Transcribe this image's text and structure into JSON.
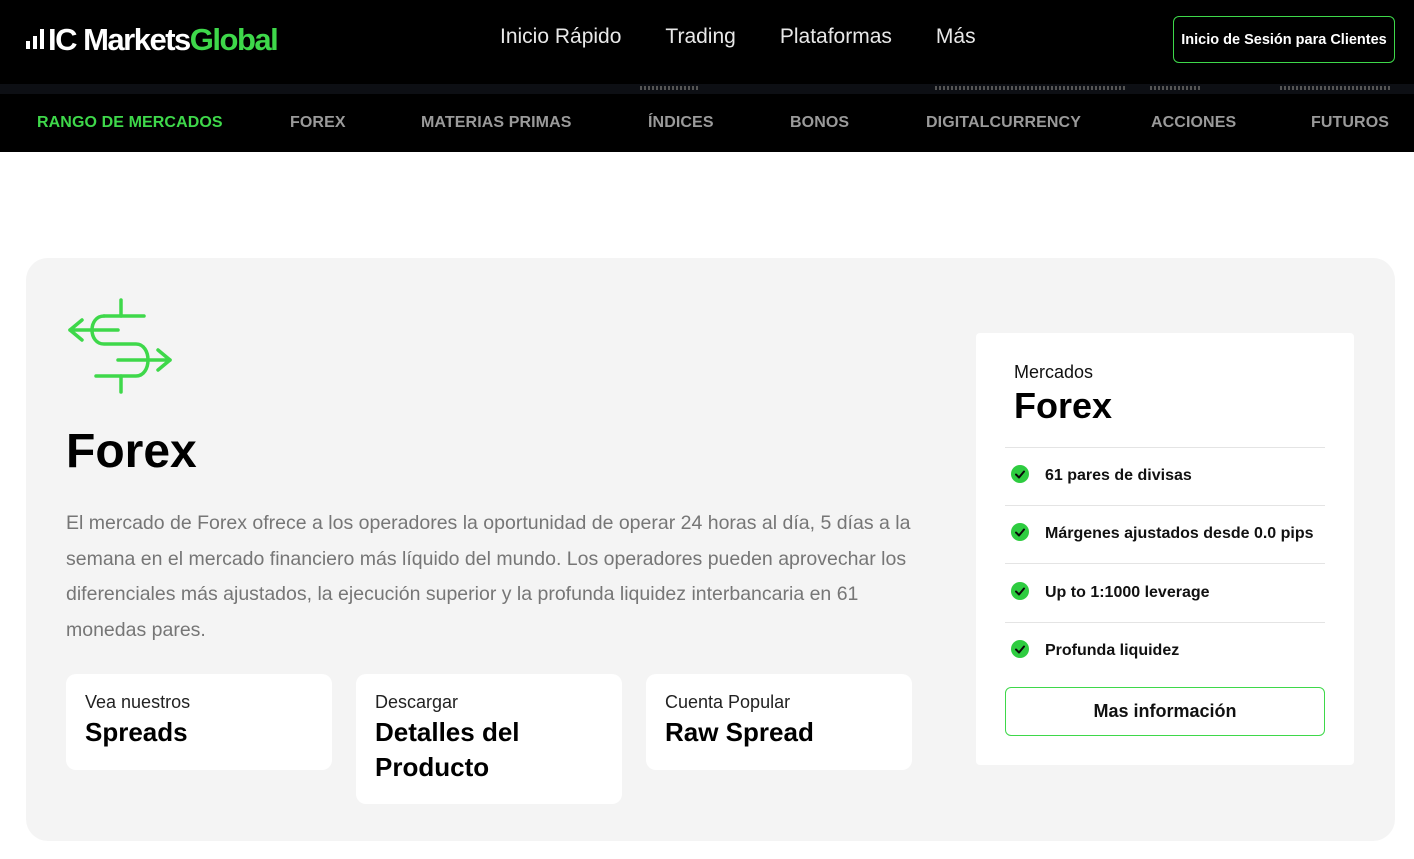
{
  "header": {
    "logo_part1": "IC Markets",
    "logo_part2": "Global",
    "nav": [
      "Inicio Rápido",
      "Trading",
      "Plataformas",
      "Más"
    ],
    "login_label": "Inicio de Sesión para Clientes"
  },
  "subnav": {
    "items": [
      "RANGO DE MERCADOS",
      "FOREX",
      "MATERIAS PRIMAS",
      "ÍNDICES",
      "BONOS",
      "DIGITALCURRENCY",
      "ACCIONES",
      "FUTUROS"
    ],
    "active": "RANGO DE MERCADOS"
  },
  "main": {
    "title": "Forex",
    "description": "El mercado de Forex ofrece a los operadores la oportunidad de operar 24 horas al día, 5 días a la semana en el mercado financiero más líquido del mundo. Los operadores pueden aprovechar los diferenciales más ajustados, la ejecución superior y la profunda liquidez interbancaria en 61 monedas pares.",
    "cards": [
      {
        "small": "Vea nuestros",
        "big": "Spreads"
      },
      {
        "small": "Descargar",
        "big": "Detalles del Producto"
      },
      {
        "small": "Cuenta Popular",
        "big": "Raw Spread"
      }
    ]
  },
  "side_panel": {
    "label": "Mercados",
    "name": "Forex",
    "features": [
      "61 pares de divisas",
      "Márgenes ajustados desde 0.0 pips",
      "Up to 1:1000 leverage",
      "Profunda liquidez"
    ],
    "button_label": "Mas información"
  },
  "colors": {
    "accent": "#3ed84a",
    "header_bg": "#000000",
    "card_bg": "#f4f4f4",
    "muted_text": "#767676"
  },
  "icons": {
    "logo": "signal-bars-icon",
    "market": "exchange-arrows-icon",
    "feature": "check-circle-icon"
  }
}
